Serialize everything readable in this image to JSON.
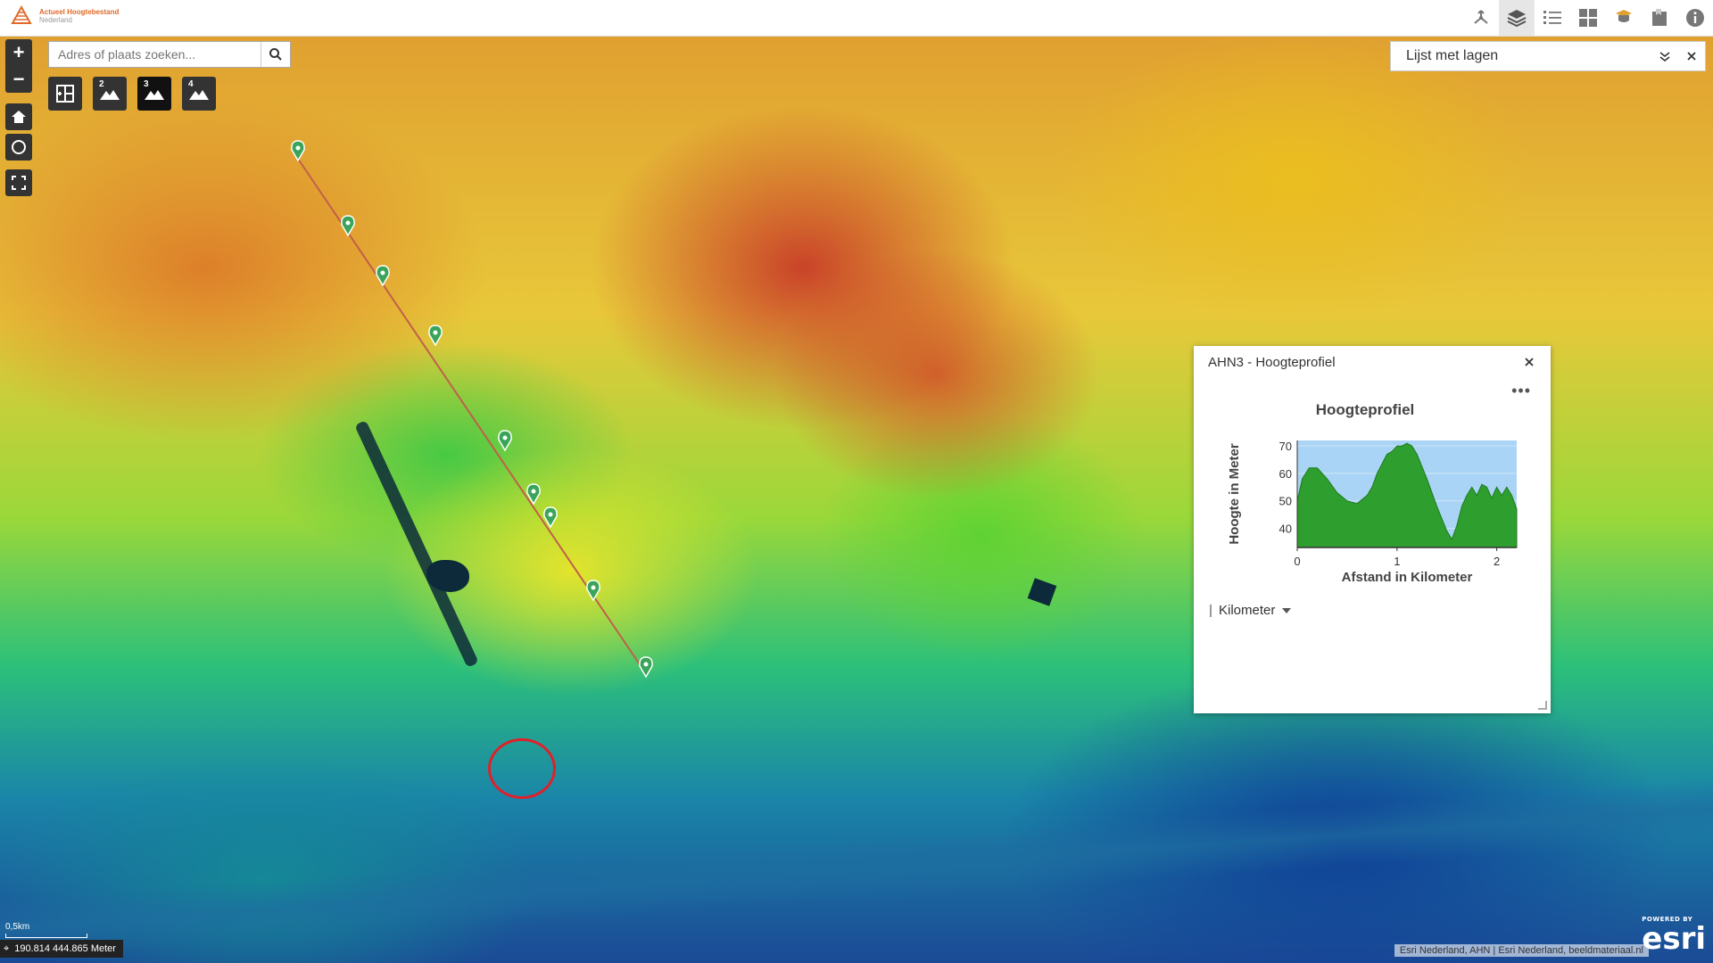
{
  "app": {
    "logo_line1": "Actueel Hoogtebestand",
    "logo_line2": "Nederland"
  },
  "toolbar": {
    "buttons": [
      "measure-icon",
      "layers-icon",
      "legend-icon",
      "basemap-gallery-icon",
      "print-icon",
      "bookmark-icon",
      "info-icon"
    ],
    "active": "layers-icon"
  },
  "search": {
    "placeholder": "Adres of plaats zoeken..."
  },
  "view_buttons": [
    "",
    "2",
    "3",
    "4"
  ],
  "layer_list": {
    "title": "Lijst met lagen"
  },
  "popup": {
    "title": "AHN3 - Hoogteprofiel",
    "unit_select": "Kilometer"
  },
  "chart_data": {
    "type": "area",
    "title": "Hoogteprofiel",
    "xlabel": "Afstand in Kilometer",
    "ylabel": "Hoogte in Meter",
    "xlim": [
      0,
      2.2
    ],
    "ylim": [
      33,
      72
    ],
    "xticks": [
      "0",
      "1",
      "2"
    ],
    "yticks": [
      "40",
      "50",
      "60",
      "70"
    ],
    "fill_color": "#2e9e2e",
    "background_color": "#a9d4f5",
    "x": [
      0,
      0.05,
      0.12,
      0.2,
      0.3,
      0.4,
      0.5,
      0.6,
      0.7,
      0.75,
      0.8,
      0.9,
      0.95,
      1.0,
      1.05,
      1.1,
      1.15,
      1.2,
      1.3,
      1.4,
      1.5,
      1.55,
      1.6,
      1.65,
      1.7,
      1.75,
      1.8,
      1.85,
      1.9,
      1.95,
      2.0,
      2.05,
      2.1,
      2.15,
      2.2
    ],
    "y": [
      50,
      58,
      62,
      62,
      58,
      53,
      50,
      49,
      52,
      55,
      60,
      67,
      68,
      70,
      70,
      71,
      70,
      67,
      58,
      48,
      39,
      36,
      41,
      48,
      52,
      55,
      52,
      56,
      55,
      51,
      55,
      52,
      55,
      52,
      47
    ]
  },
  "scale": {
    "label": "0,5km"
  },
  "coordinates": {
    "text": "190.814 444.865 Meter"
  },
  "attribution": {
    "text": "Esri Nederland, AHN | Esri Nederland, beeldmateriaal.nl"
  },
  "esri": {
    "powered": "POWERED BY",
    "brand": "esri"
  },
  "profile": {
    "line_color": "#c0604a",
    "marker_color": "#3aa55a"
  }
}
